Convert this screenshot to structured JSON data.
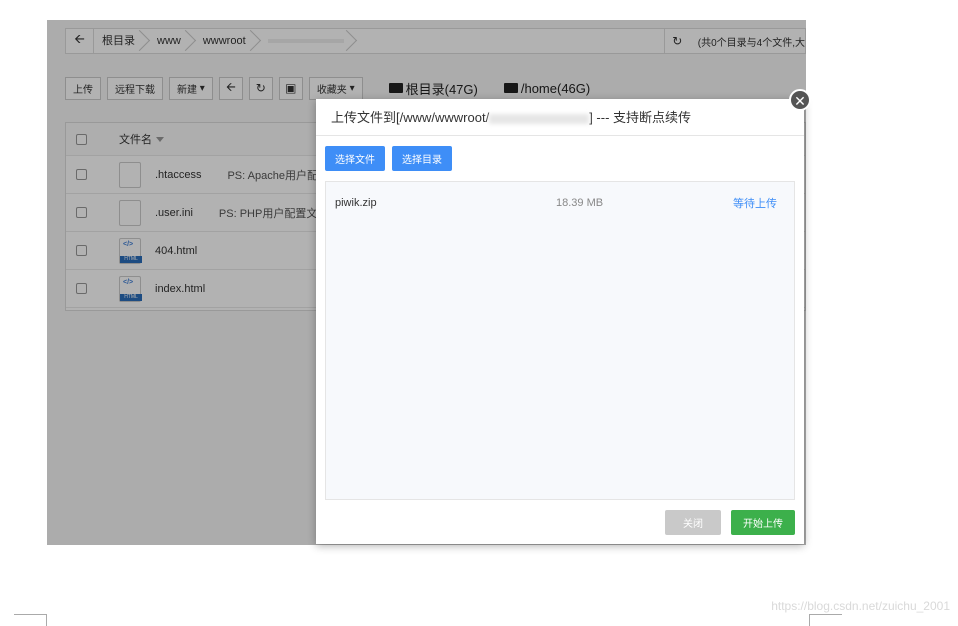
{
  "pathbar": {
    "crumbs": [
      "根目录",
      "www",
      "wwwroot"
    ],
    "summary": "(共0个目录与4个文件,大"
  },
  "toolbar": {
    "upload": "上传",
    "remote_download": "远程下载",
    "new": "新建",
    "favorites": "收藏夹",
    "disks": [
      "根目录(47G)",
      "/home(46G)"
    ]
  },
  "filetable": {
    "header_name": "文件名",
    "files": [
      {
        "name": ".htaccess",
        "ps": "PS: Apache用户配"
      },
      {
        "name": ".user.ini",
        "ps": "PS: PHP用户配置文"
      },
      {
        "name": "404.html",
        "ps": ""
      },
      {
        "name": "index.html",
        "ps": ""
      }
    ]
  },
  "modal": {
    "title_prefix": "上传文件到[/www/wwwroot/",
    "title_suffix": "] --- 支持断点续传",
    "select_file": "选择文件",
    "select_dir": "选择目录",
    "uploads": [
      {
        "name": "piwik.zip",
        "size": "18.39 MB",
        "status": "等待上传"
      }
    ],
    "close": "关闭",
    "start": "开始上传"
  },
  "watermark": "https://blog.csdn.net/zuichu_2001"
}
